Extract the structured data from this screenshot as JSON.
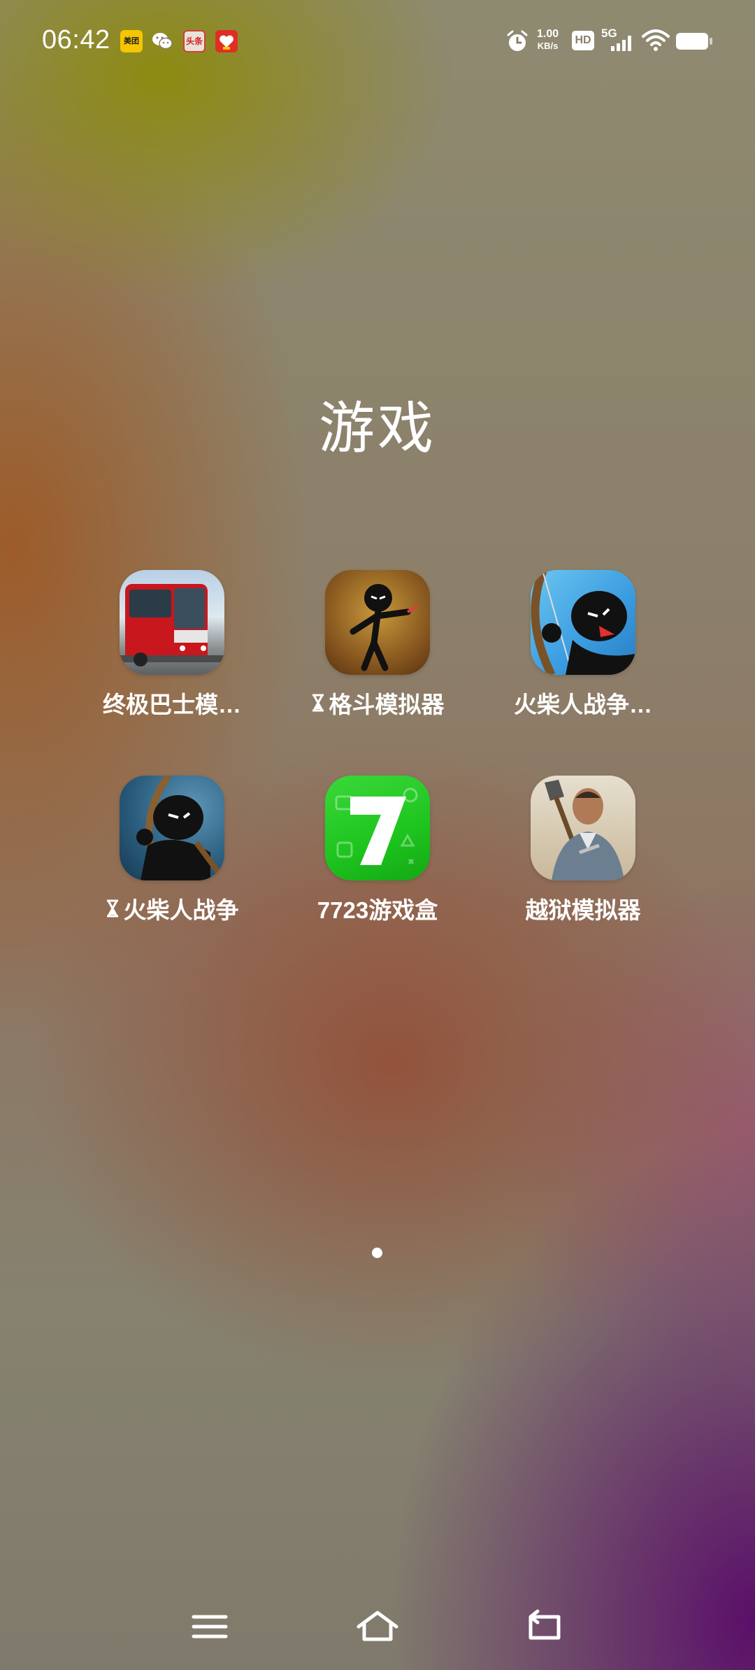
{
  "status_bar": {
    "time": "06:42",
    "net_speed_value": "1.00",
    "net_speed_unit": "KB/s",
    "hd_badge": "HD",
    "network_type": "5G",
    "notification_icons": [
      "meituan-icon",
      "wechat-icon",
      "toutiao-icon",
      "pinduoduo-icon"
    ],
    "notif_labels": {
      "meituan": "美团",
      "toutiao": "头条"
    }
  },
  "folder": {
    "title": "游戏",
    "apps": [
      {
        "label": "终极巴士模…",
        "waiting": false,
        "icon": "bus-simulator-icon"
      },
      {
        "label": "格斗模拟器",
        "waiting": true,
        "icon": "fight-simulator-icon"
      },
      {
        "label": "火柴人战争…",
        "waiting": false,
        "icon": "stickman-war-legacy-icon"
      },
      {
        "label": "火柴人战争",
        "waiting": true,
        "icon": "stickman-war-icon"
      },
      {
        "label": "7723游戏盒",
        "waiting": false,
        "icon": "7723-game-box-icon",
        "glyph": "7"
      },
      {
        "label": "越狱模拟器",
        "waiting": false,
        "icon": "prison-escape-simulator-icon"
      }
    ]
  },
  "pager": {
    "pages": 1,
    "current": 1
  },
  "nav_bar": {
    "buttons": [
      "menu-icon",
      "home-icon",
      "back-icon"
    ]
  },
  "colors": {
    "game_box_green": "#1ec41e",
    "bus_red": "#c8171d",
    "sky_blue": "#3a9be0"
  }
}
